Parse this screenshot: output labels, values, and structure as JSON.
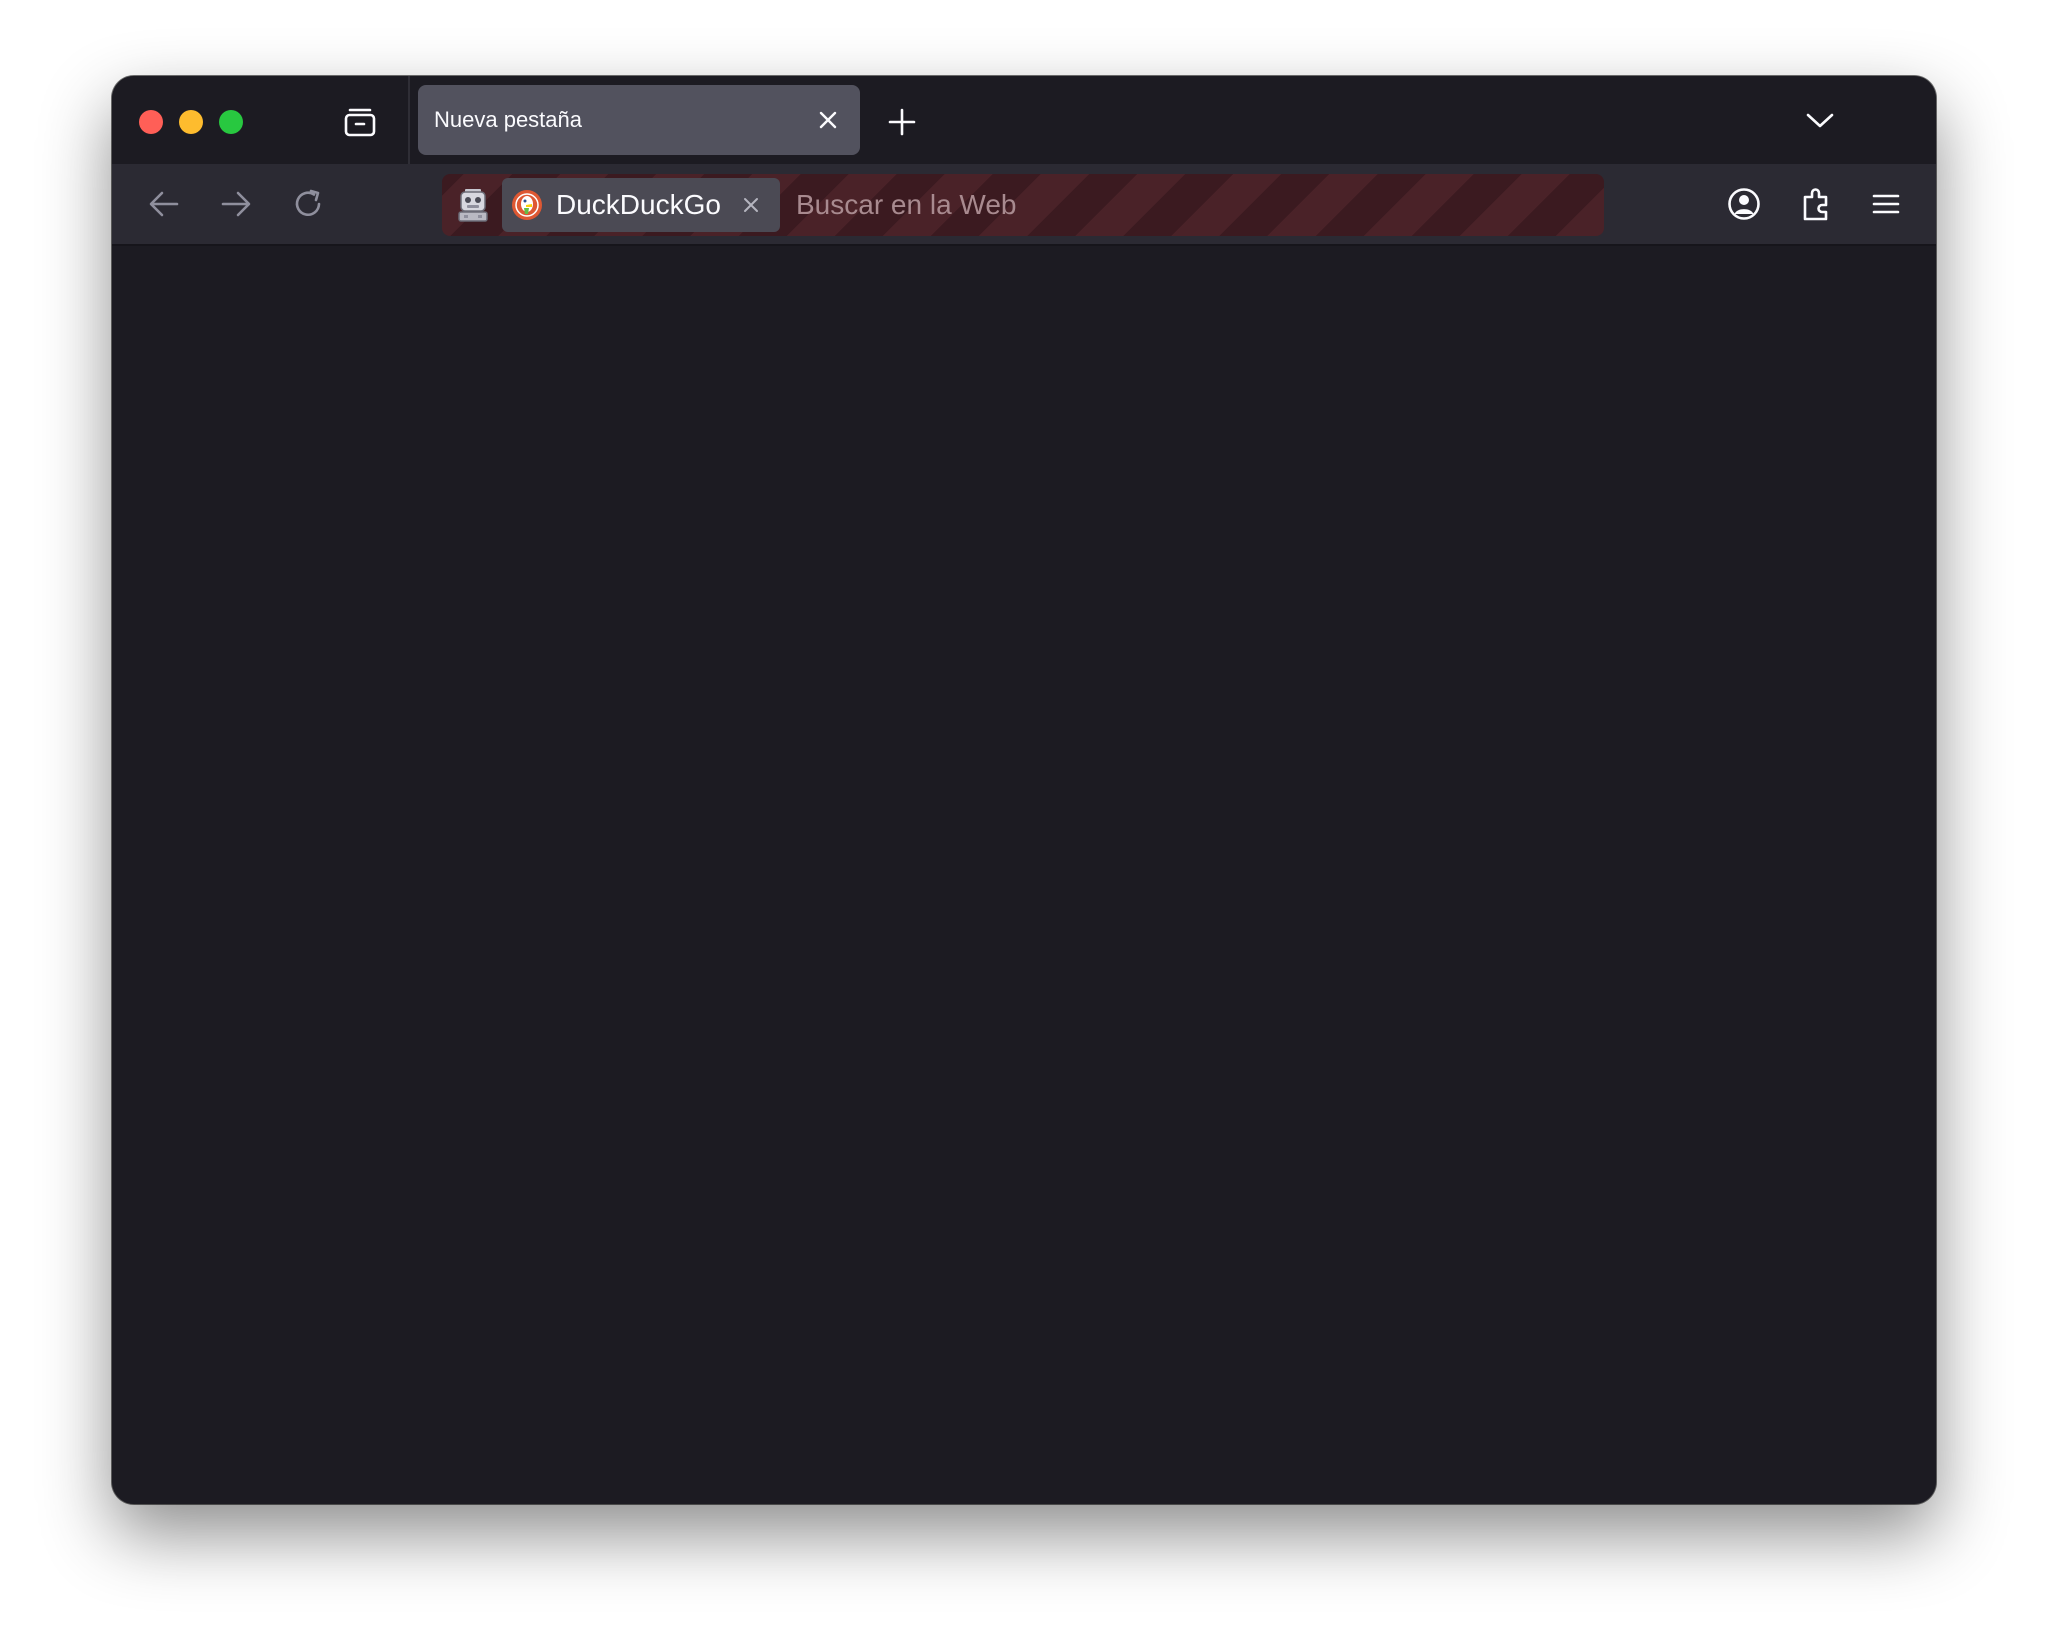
{
  "window": {
    "controls": [
      "close",
      "minimize",
      "maximize"
    ]
  },
  "tabs": [
    {
      "title": "Nueva pestaña",
      "active": true
    }
  ],
  "urlbar": {
    "search_engine": "DuckDuckGo",
    "placeholder": "Buscar en la Web",
    "value": ""
  },
  "icons": {
    "tab_overview": "tab-overview-icon",
    "new_tab": "plus-icon",
    "list_all_tabs": "chevron-down-icon",
    "back": "arrow-left-icon",
    "forward": "arrow-right-icon",
    "reload": "reload-icon",
    "private_mode": "robot-icon",
    "account": "account-icon",
    "extensions": "puzzle-icon",
    "menu": "hamburger-menu-icon"
  },
  "colors": {
    "window_bg": "#1c1b22",
    "toolbar_bg": "#2b2a33",
    "active_tab": "#52525e",
    "urlbar_stripe_a": "#4a2228",
    "urlbar_stripe_b": "#3b1a20",
    "ddg_brand": "#de5833"
  }
}
